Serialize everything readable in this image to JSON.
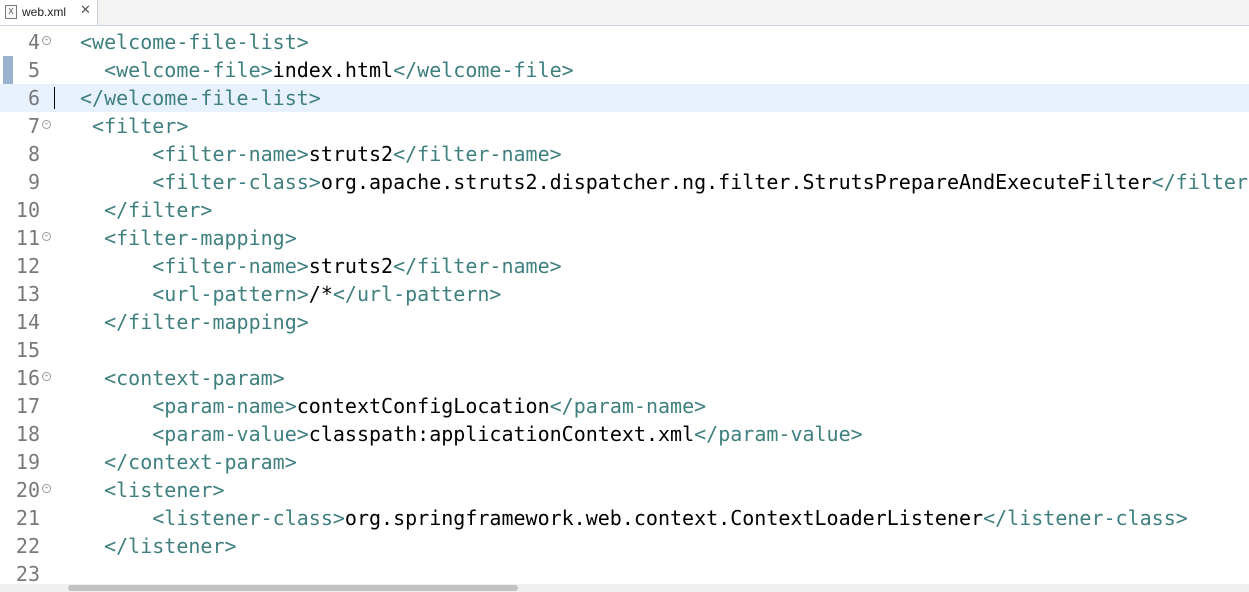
{
  "tab": {
    "title": "web.xml",
    "icon": "xml-file-icon",
    "close_glyph": "✕",
    "icon_glyph": "X"
  },
  "colors": {
    "tag": "#3f7f7f",
    "text": "#000000",
    "line_number": "#787878",
    "current_line": "#e8f2fe"
  },
  "lines": [
    {
      "number": "4",
      "fold": true,
      "current": false,
      "indent": "",
      "parts": [
        {
          "t": "tag",
          "v": "<welcome-file-list>"
        }
      ]
    },
    {
      "number": "5",
      "fold": false,
      "current": false,
      "indent": "  ",
      "parts": [
        {
          "t": "tag",
          "v": "<welcome-file>"
        },
        {
          "t": "txt",
          "v": "index.html"
        },
        {
          "t": "tag",
          "v": "</welcome-file>"
        }
      ]
    },
    {
      "number": "6",
      "fold": false,
      "current": true,
      "indent": "",
      "parts": [
        {
          "t": "tag",
          "v": "</welcome-file-list>"
        }
      ]
    },
    {
      "number": "7",
      "fold": true,
      "current": false,
      "indent": " ",
      "parts": [
        {
          "t": "tag",
          "v": "<filter>"
        }
      ]
    },
    {
      "number": "8",
      "fold": false,
      "current": false,
      "indent": "      ",
      "parts": [
        {
          "t": "tag",
          "v": "<filter-name>"
        },
        {
          "t": "txt",
          "v": "struts2"
        },
        {
          "t": "tag",
          "v": "</filter-name>"
        }
      ]
    },
    {
      "number": "9",
      "fold": false,
      "current": false,
      "indent": "      ",
      "parts": [
        {
          "t": "tag",
          "v": "<filter-class>"
        },
        {
          "t": "txt",
          "v": "org.apache.struts2.dispatcher.ng.filter.StrutsPrepareAndExecuteFilter"
        },
        {
          "t": "tag",
          "v": "</filter-class>"
        }
      ]
    },
    {
      "number": "10",
      "fold": false,
      "current": false,
      "indent": "  ",
      "parts": [
        {
          "t": "tag",
          "v": "</filter>"
        }
      ]
    },
    {
      "number": "11",
      "fold": true,
      "current": false,
      "indent": "  ",
      "parts": [
        {
          "t": "tag",
          "v": "<filter-mapping>"
        }
      ]
    },
    {
      "number": "12",
      "fold": false,
      "current": false,
      "indent": "      ",
      "parts": [
        {
          "t": "tag",
          "v": "<filter-name>"
        },
        {
          "t": "txt",
          "v": "struts2"
        },
        {
          "t": "tag",
          "v": "</filter-name>"
        }
      ]
    },
    {
      "number": "13",
      "fold": false,
      "current": false,
      "indent": "      ",
      "parts": [
        {
          "t": "tag",
          "v": "<url-pattern>"
        },
        {
          "t": "txt",
          "v": "/*"
        },
        {
          "t": "tag",
          "v": "</url-pattern>"
        }
      ]
    },
    {
      "number": "14",
      "fold": false,
      "current": false,
      "indent": "  ",
      "parts": [
        {
          "t": "tag",
          "v": "</filter-mapping>"
        }
      ]
    },
    {
      "number": "15",
      "fold": false,
      "current": false,
      "indent": "",
      "parts": []
    },
    {
      "number": "16",
      "fold": true,
      "current": false,
      "indent": "  ",
      "parts": [
        {
          "t": "tag",
          "v": "<context-param>"
        }
      ]
    },
    {
      "number": "17",
      "fold": false,
      "current": false,
      "indent": "      ",
      "parts": [
        {
          "t": "tag",
          "v": "<param-name>"
        },
        {
          "t": "txt",
          "v": "contextConfigLocation"
        },
        {
          "t": "tag",
          "v": "</param-name>"
        }
      ]
    },
    {
      "number": "18",
      "fold": false,
      "current": false,
      "indent": "      ",
      "parts": [
        {
          "t": "tag",
          "v": "<param-value>"
        },
        {
          "t": "txt",
          "v": "classpath:applicationContext.xml"
        },
        {
          "t": "tag",
          "v": "</param-value>"
        }
      ]
    },
    {
      "number": "19",
      "fold": false,
      "current": false,
      "indent": "  ",
      "parts": [
        {
          "t": "tag",
          "v": "</context-param>"
        }
      ]
    },
    {
      "number": "20",
      "fold": true,
      "current": false,
      "indent": "  ",
      "parts": [
        {
          "t": "tag",
          "v": "<listener>"
        }
      ]
    },
    {
      "number": "21",
      "fold": false,
      "current": false,
      "indent": "      ",
      "parts": [
        {
          "t": "tag",
          "v": "<listener-class>"
        },
        {
          "t": "txt",
          "v": "org.springframework.web.context.ContextLoaderListener"
        },
        {
          "t": "tag",
          "v": "</listener-class>"
        }
      ]
    },
    {
      "number": "22",
      "fold": false,
      "current": false,
      "indent": "  ",
      "parts": [
        {
          "t": "tag",
          "v": "</listener>"
        }
      ]
    },
    {
      "number": "23",
      "fold": false,
      "current": false,
      "indent": "",
      "parts": []
    }
  ]
}
